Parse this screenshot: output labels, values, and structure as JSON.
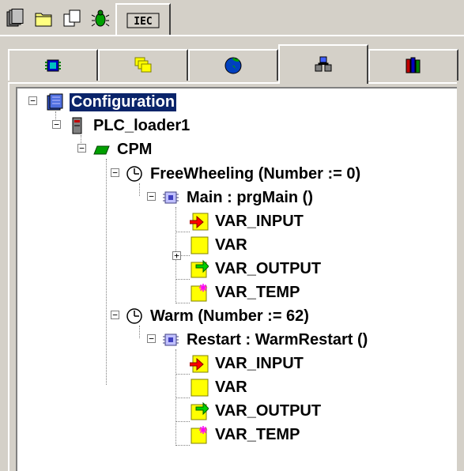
{
  "toolbar": {
    "buttons": [
      {
        "icon": "pages-icon"
      },
      {
        "icon": "folder-icon"
      },
      {
        "icon": "copy-icon"
      },
      {
        "icon": "bug-icon"
      },
      {
        "icon": "iec-icon",
        "label": "IEC"
      }
    ]
  },
  "tabs": [
    {
      "icon": "blue-chip-icon"
    },
    {
      "icon": "yellow-windows-icon"
    },
    {
      "icon": "globe-icon"
    },
    {
      "icon": "network-icon"
    },
    {
      "icon": "books-icon"
    }
  ],
  "tree": {
    "nodes": [
      {
        "label": "Configuration",
        "selected": true
      },
      {
        "label": "PLC_loader1"
      },
      {
        "label": "CPM"
      },
      {
        "label": "FreeWheeling (Number := 0)"
      },
      {
        "label": "Main : prgMain ()"
      },
      {
        "label": "VAR_INPUT"
      },
      {
        "label": "VAR"
      },
      {
        "label": "VAR_OUTPUT"
      },
      {
        "label": "VAR_TEMP"
      },
      {
        "label": "Warm (Number := 62)"
      },
      {
        "label": "Restart : WarmRestart ()"
      },
      {
        "label": "VAR_INPUT"
      },
      {
        "label": "VAR"
      },
      {
        "label": "VAR_OUTPUT"
      },
      {
        "label": "VAR_TEMP"
      }
    ]
  },
  "colors": {
    "face": "#d4d0c8",
    "selection": "#0a246a",
    "var_yellow": "#ffff00",
    "arrow_red": "#ff0000",
    "arrow_green": "#00c000",
    "star_magenta": "#ff00ff"
  }
}
